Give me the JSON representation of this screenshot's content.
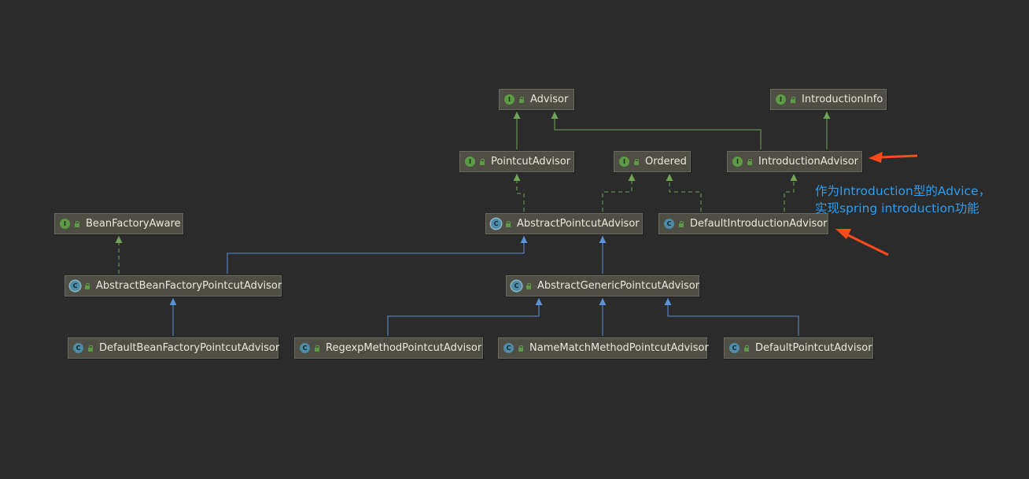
{
  "colors": {
    "background": "#2b2b2b",
    "node_fill": "#4f4e44",
    "interface_icon": "#5d9a45",
    "class_icon": "#4e8ba6",
    "implements_edge": "#6fa356",
    "extends_edge": "#5a93d8",
    "callout_arrow": "#ff4a1a",
    "annotation_text": "#2a9df4"
  },
  "nodes": [
    {
      "id": "advisor",
      "label": "Advisor",
      "kind": "interface",
      "icon": "interface-icon"
    },
    {
      "id": "introduction-info",
      "label": "IntroductionInfo",
      "kind": "interface",
      "icon": "interface-icon"
    },
    {
      "id": "pointcut-advisor",
      "label": "PointcutAdvisor",
      "kind": "interface",
      "icon": "interface-icon"
    },
    {
      "id": "ordered",
      "label": "Ordered",
      "kind": "interface",
      "icon": "interface-icon"
    },
    {
      "id": "introduction-advisor",
      "label": "IntroductionAdvisor",
      "kind": "interface",
      "icon": "interface-icon"
    },
    {
      "id": "bean-factory-aware",
      "label": "BeanFactoryAware",
      "kind": "interface",
      "icon": "interface-icon"
    },
    {
      "id": "abstract-pointcut-advisor",
      "label": "AbstractPointcutAdvisor",
      "kind": "abstract",
      "icon": "abstract-class-icon"
    },
    {
      "id": "default-introduction-advisor",
      "label": "DefaultIntroductionAdvisor",
      "kind": "class",
      "icon": "class-icon"
    },
    {
      "id": "abstract-bean-factory-pointcut-advisor",
      "label": "AbstractBeanFactoryPointcutAdvisor",
      "kind": "abstract",
      "icon": "abstract-class-icon"
    },
    {
      "id": "abstract-generic-pointcut-advisor",
      "label": "AbstractGenericPointcutAdvisor",
      "kind": "abstract",
      "icon": "abstract-class-icon"
    },
    {
      "id": "default-bean-factory-pointcut-advisor",
      "label": "DefaultBeanFactoryPointcutAdvisor",
      "kind": "class",
      "icon": "class-icon"
    },
    {
      "id": "regexp-method-pointcut-advisor",
      "label": "RegexpMethodPointcutAdvisor",
      "kind": "class",
      "icon": "class-icon"
    },
    {
      "id": "name-match-method-pointcut-advisor",
      "label": "NameMatchMethodPointcutAdvisor",
      "kind": "class",
      "icon": "class-icon"
    },
    {
      "id": "default-pointcut-advisor",
      "label": "DefaultPointcutAdvisor",
      "kind": "class",
      "icon": "class-icon"
    }
  ],
  "edges": [
    {
      "from": "pointcut-advisor",
      "to": "advisor",
      "type": "extends-interface"
    },
    {
      "from": "introduction-advisor",
      "to": "advisor",
      "type": "extends-interface"
    },
    {
      "from": "introduction-advisor",
      "to": "introduction-info",
      "type": "extends-interface"
    },
    {
      "from": "abstract-pointcut-advisor",
      "to": "pointcut-advisor",
      "type": "implements"
    },
    {
      "from": "abstract-pointcut-advisor",
      "to": "ordered",
      "type": "implements"
    },
    {
      "from": "default-introduction-advisor",
      "to": "ordered",
      "type": "implements"
    },
    {
      "from": "default-introduction-advisor",
      "to": "introduction-advisor",
      "type": "implements"
    },
    {
      "from": "abstract-bean-factory-pointcut-advisor",
      "to": "bean-factory-aware",
      "type": "implements"
    },
    {
      "from": "abstract-bean-factory-pointcut-advisor",
      "to": "abstract-pointcut-advisor",
      "type": "extends"
    },
    {
      "from": "abstract-generic-pointcut-advisor",
      "to": "abstract-pointcut-advisor",
      "type": "extends"
    },
    {
      "from": "default-bean-factory-pointcut-advisor",
      "to": "abstract-bean-factory-pointcut-advisor",
      "type": "extends"
    },
    {
      "from": "regexp-method-pointcut-advisor",
      "to": "abstract-generic-pointcut-advisor",
      "type": "extends"
    },
    {
      "from": "name-match-method-pointcut-advisor",
      "to": "abstract-generic-pointcut-advisor",
      "type": "extends"
    },
    {
      "from": "default-pointcut-advisor",
      "to": "abstract-generic-pointcut-advisor",
      "type": "extends"
    }
  ],
  "annotation": {
    "lines": [
      "作为Introduction型的Advice，",
      "实现spring introduction功能"
    ]
  }
}
